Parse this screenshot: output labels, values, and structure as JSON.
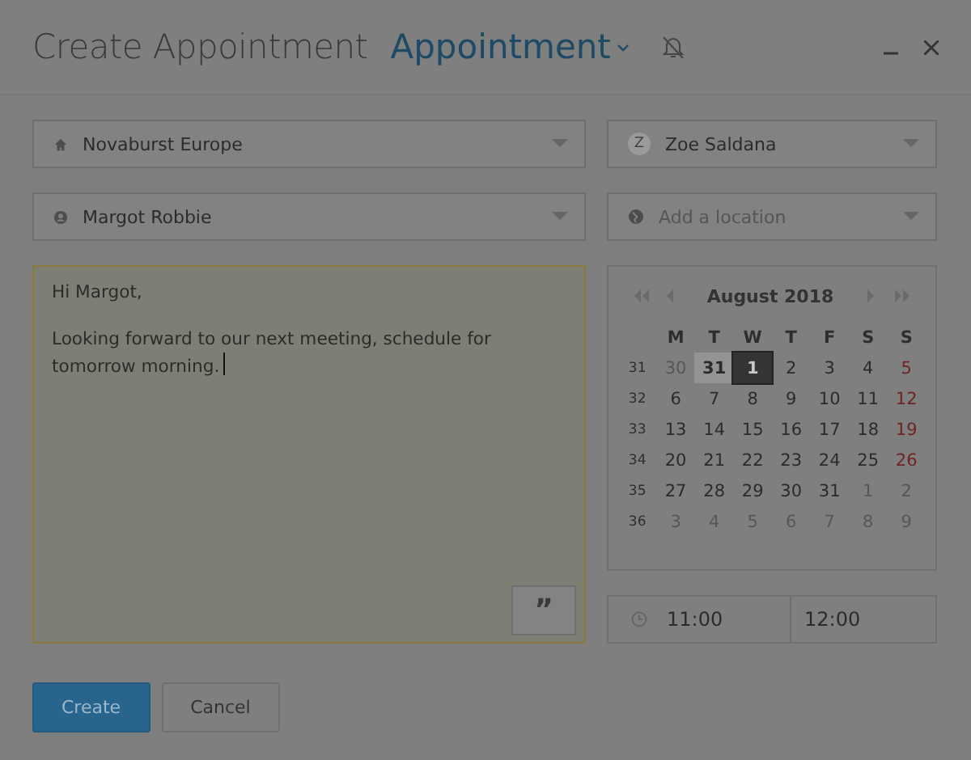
{
  "header": {
    "title": "Create Appointment",
    "type_selector": "Appointment"
  },
  "fields": [
    {
      "value": "Novaburst Europe"
    },
    {
      "avatar": "Z",
      "value": "Zoe Saldana"
    },
    {
      "value": "Margot Robbie"
    },
    {
      "placeholder": "Add a location"
    }
  ],
  "message": {
    "paragraphs": [
      "Hi Margot,",
      "Looking forward to our next meeting, schedule for tomorrow morning."
    ],
    "quote_button": "”"
  },
  "calendar": {
    "title": "August 2018",
    "weekdays": [
      "M",
      "T",
      "W",
      "T",
      "F",
      "S",
      "S"
    ],
    "weeks": [
      {
        "number": "31",
        "days": [
          {
            "d": "30",
            "kind": "muted",
            "selected": false,
            "today": false
          },
          {
            "d": "31",
            "kind": "normal",
            "selected": false,
            "today": true
          },
          {
            "d": "1",
            "kind": "normal",
            "selected": true,
            "today": false
          },
          {
            "d": "2",
            "kind": "normal",
            "selected": false,
            "today": false
          },
          {
            "d": "3",
            "kind": "normal",
            "selected": false,
            "today": false
          },
          {
            "d": "4",
            "kind": "normal",
            "selected": false,
            "today": false
          },
          {
            "d": "5",
            "kind": "sunday",
            "selected": false,
            "today": false
          }
        ]
      },
      {
        "number": "32",
        "days": [
          {
            "d": "6",
            "kind": "normal",
            "selected": false,
            "today": false
          },
          {
            "d": "7",
            "kind": "normal",
            "selected": false,
            "today": false
          },
          {
            "d": "8",
            "kind": "normal",
            "selected": false,
            "today": false
          },
          {
            "d": "9",
            "kind": "normal",
            "selected": false,
            "today": false
          },
          {
            "d": "10",
            "kind": "normal",
            "selected": false,
            "today": false
          },
          {
            "d": "11",
            "kind": "normal",
            "selected": false,
            "today": false
          },
          {
            "d": "12",
            "kind": "sunday",
            "selected": false,
            "today": false
          }
        ]
      },
      {
        "number": "33",
        "days": [
          {
            "d": "13",
            "kind": "normal",
            "selected": false,
            "today": false
          },
          {
            "d": "14",
            "kind": "normal",
            "selected": false,
            "today": false
          },
          {
            "d": "15",
            "kind": "normal",
            "selected": false,
            "today": false
          },
          {
            "d": "16",
            "kind": "normal",
            "selected": false,
            "today": false
          },
          {
            "d": "17",
            "kind": "normal",
            "selected": false,
            "today": false
          },
          {
            "d": "18",
            "kind": "normal",
            "selected": false,
            "today": false
          },
          {
            "d": "19",
            "kind": "sunday",
            "selected": false,
            "today": false
          }
        ]
      },
      {
        "number": "34",
        "days": [
          {
            "d": "20",
            "kind": "normal",
            "selected": false,
            "today": false
          },
          {
            "d": "21",
            "kind": "normal",
            "selected": false,
            "today": false
          },
          {
            "d": "22",
            "kind": "normal",
            "selected": false,
            "today": false
          },
          {
            "d": "23",
            "kind": "normal",
            "selected": false,
            "today": false
          },
          {
            "d": "24",
            "kind": "normal",
            "selected": false,
            "today": false
          },
          {
            "d": "25",
            "kind": "normal",
            "selected": false,
            "today": false
          },
          {
            "d": "26",
            "kind": "sunday",
            "selected": false,
            "today": false
          }
        ]
      },
      {
        "number": "35",
        "days": [
          {
            "d": "27",
            "kind": "normal",
            "selected": false,
            "today": false
          },
          {
            "d": "28",
            "kind": "normal",
            "selected": false,
            "today": false
          },
          {
            "d": "29",
            "kind": "normal",
            "selected": false,
            "today": false
          },
          {
            "d": "30",
            "kind": "normal",
            "selected": false,
            "today": false
          },
          {
            "d": "31",
            "kind": "normal",
            "selected": false,
            "today": false
          },
          {
            "d": "1",
            "kind": "muted",
            "selected": false,
            "today": false
          },
          {
            "d": "2",
            "kind": "muted",
            "selected": false,
            "today": false
          }
        ]
      },
      {
        "number": "36",
        "days": [
          {
            "d": "3",
            "kind": "muted",
            "selected": false,
            "today": false
          },
          {
            "d": "4",
            "kind": "muted",
            "selected": false,
            "today": false
          },
          {
            "d": "5",
            "kind": "muted",
            "selected": false,
            "today": false
          },
          {
            "d": "6",
            "kind": "muted",
            "selected": false,
            "today": false
          },
          {
            "d": "7",
            "kind": "muted",
            "selected": false,
            "today": false
          },
          {
            "d": "8",
            "kind": "muted",
            "selected": false,
            "today": false
          },
          {
            "d": "9",
            "kind": "muted",
            "selected": false,
            "today": false
          }
        ]
      }
    ]
  },
  "time": {
    "start": "11:00",
    "end": "12:00"
  },
  "buttons": [
    {
      "label": "Create",
      "kind": "primary"
    },
    {
      "label": "Cancel",
      "kind": "secondary"
    }
  ]
}
